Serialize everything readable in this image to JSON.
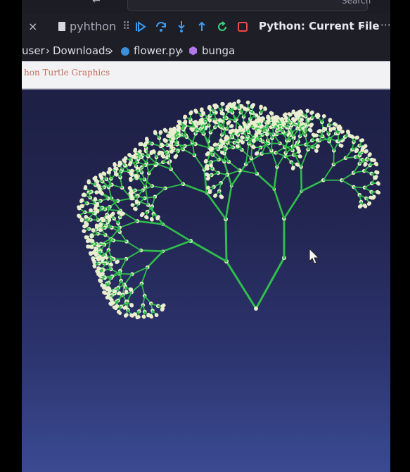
{
  "toolbar": {
    "tab_label": "pyhthon",
    "run_config": "Python: Current File",
    "search_label": "Search"
  },
  "breadcrumbs": {
    "user": "user",
    "downloads": "Downloads",
    "file": "flower.py",
    "symbol": "bunga"
  },
  "turtle_window": {
    "title": "hon Turtle Graphics"
  },
  "colors": {
    "branch": "#2fbf4a",
    "blossom": "#eaeecf",
    "canvas_top": "#1a1c3c",
    "canvas_bottom": "#3a4a92"
  },
  "icons": [
    "close-icon",
    "file-icon",
    "grip-icon",
    "continue-icon",
    "step-over-icon",
    "step-into-icon",
    "step-out-icon",
    "restart-icon",
    "stop-icon",
    "chevron-down-icon",
    "python-file-icon",
    "symbol-cube-icon",
    "mouse-cursor-icon"
  ]
}
